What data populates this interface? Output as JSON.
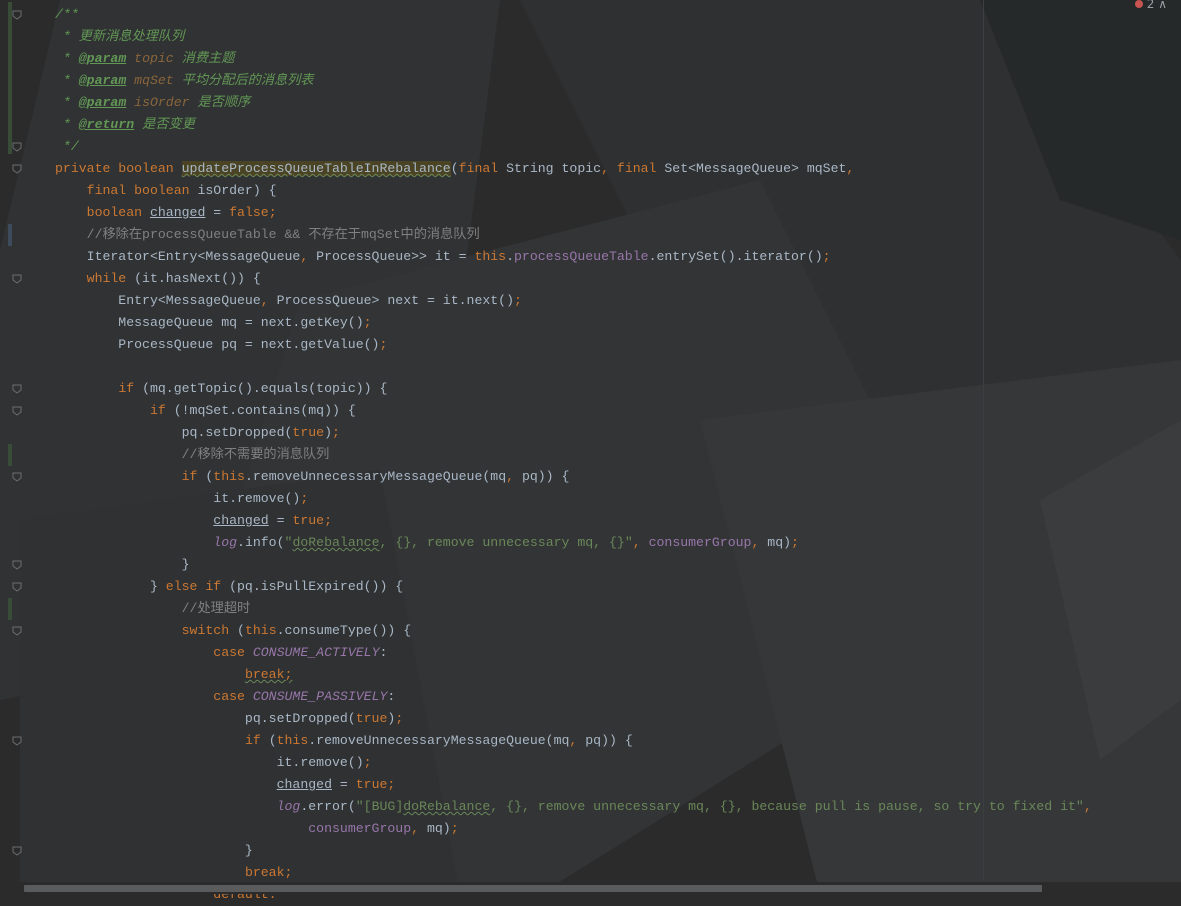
{
  "editor": {
    "error_count": "2",
    "error_marker_icon": "error-dot-icon",
    "lines": [
      "/**",
      " * 更新消息处理队列",
      " * @param topic 消费主题",
      " * @param mqSet 平均分配后的消息列表",
      " * @param isOrder 是否顺序",
      " * @return 是否变更",
      " */",
      "private boolean updateProcessQueueTableInRebalance(final String topic, final Set<MessageQueue> mqSet,",
      "    final boolean isOrder) {",
      "    boolean changed = false;",
      "    //移除在processQueueTable && 不存在于mqSet中的消息队列",
      "    Iterator<Entry<MessageQueue, ProcessQueue>> it = this.processQueueTable.entrySet().iterator();",
      "    while (it.hasNext()) {",
      "        Entry<MessageQueue, ProcessQueue> next = it.next();",
      "        MessageQueue mq = next.getKey();",
      "        ProcessQueue pq = next.getValue();",
      "",
      "        if (mq.getTopic().equals(topic)) {",
      "            if (!mqSet.contains(mq)) {",
      "                pq.setDropped(true);",
      "                //移除不需要的消息队列",
      "                if (this.removeUnnecessaryMessageQueue(mq, pq)) {",
      "                    it.remove();",
      "                    changed = true;",
      "                    log.info(\"doRebalance, {}, remove unnecessary mq, {}\", consumerGroup, mq);",
      "                }",
      "            } else if (pq.isPullExpired()) {",
      "                //处理超时",
      "                switch (this.consumeType()) {",
      "                    case CONSUME_ACTIVELY:",
      "                        break;",
      "                    case CONSUME_PASSIVELY:",
      "                        pq.setDropped(true);",
      "                        if (this.removeUnnecessaryMessageQueue(mq, pq)) {",
      "                            it.remove();",
      "                            changed = true;",
      "                            log.error(\"[BUG]doRebalance, {}, remove unnecessary mq, {}, because pull is pause, so try to fixed it\",",
      "                                consumerGroup, mq);",
      "                        }",
      "                        break;",
      "                    default:"
    ]
  },
  "theme": {
    "background": "#2b2b2b",
    "keyword": "#cc7832",
    "string": "#6a8759",
    "comment": "#808080",
    "doc_comment": "#629755",
    "field": "#9876aa",
    "text": "#a9b7c6",
    "usage_highlight": "#4a4424",
    "error": "#c75450"
  }
}
